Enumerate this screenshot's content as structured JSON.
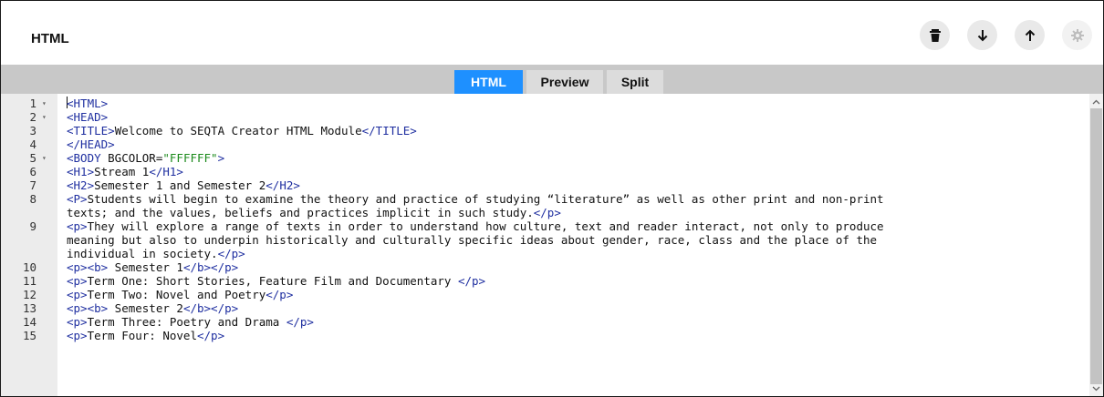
{
  "header": {
    "title": "HTML",
    "buttons": [
      {
        "name": "delete-button",
        "icon": "trash-icon"
      },
      {
        "name": "move-down-button",
        "icon": "arrow-down-icon"
      },
      {
        "name": "move-up-button",
        "icon": "arrow-up-icon"
      },
      {
        "name": "settings-button",
        "icon": "gear-icon",
        "disabled": true
      }
    ]
  },
  "tabs": [
    {
      "label": "HTML",
      "active": true
    },
    {
      "label": "Preview",
      "active": false
    },
    {
      "label": "Split",
      "active": false
    }
  ],
  "colors": {
    "accent": "#1e90ff",
    "tag": "#1f2fa0",
    "string": "#1b8a1b"
  },
  "editor": {
    "lines": [
      {
        "num": "1",
        "fold": true,
        "parts": [
          {
            "t": "<HTML>",
            "c": "tag"
          }
        ]
      },
      {
        "num": "2",
        "fold": true,
        "parts": [
          {
            "t": "<HEAD>",
            "c": "tag"
          }
        ]
      },
      {
        "num": "3",
        "fold": false,
        "parts": [
          {
            "t": "<TITLE>",
            "c": "tag"
          },
          {
            "t": "Welcome to SEQTA Creator HTML Module",
            "c": "text"
          },
          {
            "t": "</TITLE>",
            "c": "tag"
          }
        ]
      },
      {
        "num": "4",
        "fold": false,
        "parts": [
          {
            "t": "</HEAD>",
            "c": "tag"
          }
        ]
      },
      {
        "num": "5",
        "fold": true,
        "parts": [
          {
            "t": "<BODY ",
            "c": "tag"
          },
          {
            "t": "BGCOLOR=",
            "c": "text"
          },
          {
            "t": "\"FFFFFF\"",
            "c": "str"
          },
          {
            "t": ">",
            "c": "tag"
          }
        ]
      },
      {
        "num": "6",
        "fold": false,
        "parts": [
          {
            "t": "<H1>",
            "c": "tag"
          },
          {
            "t": "Stream 1",
            "c": "text"
          },
          {
            "t": "</H1>",
            "c": "tag"
          }
        ]
      },
      {
        "num": "7",
        "fold": false,
        "parts": [
          {
            "t": "<H2>",
            "c": "tag"
          },
          {
            "t": "Semester 1 and Semester 2",
            "c": "text"
          },
          {
            "t": "</H2>",
            "c": "tag"
          }
        ]
      },
      {
        "num": "8",
        "fold": false,
        "parts": [
          {
            "t": "<P>",
            "c": "tag"
          },
          {
            "t": "Students will begin to examine the theory and practice of studying “literature” as well as other print and non-print",
            "c": "text"
          }
        ]
      },
      {
        "num": "",
        "fold": false,
        "parts": [
          {
            "t": "texts; and the values, beliefs and practices implicit in such study.",
            "c": "text"
          },
          {
            "t": "</p>",
            "c": "tag"
          }
        ]
      },
      {
        "num": "9",
        "fold": false,
        "parts": [
          {
            "t": "<p>",
            "c": "tag"
          },
          {
            "t": "They will explore a range of texts in order to understand how culture, text and reader interact, not only to produce",
            "c": "text"
          }
        ]
      },
      {
        "num": "",
        "fold": false,
        "parts": [
          {
            "t": "meaning but also to underpin historically and culturally specific ideas about gender, race, class and the place of the",
            "c": "text"
          }
        ]
      },
      {
        "num": "",
        "fold": false,
        "parts": [
          {
            "t": "individual in society.",
            "c": "text"
          },
          {
            "t": "</p>",
            "c": "tag"
          }
        ]
      },
      {
        "num": "10",
        "fold": false,
        "parts": [
          {
            "t": "<p><b>",
            "c": "tag"
          },
          {
            "t": " Semester 1",
            "c": "text"
          },
          {
            "t": "</b></p>",
            "c": "tag"
          }
        ]
      },
      {
        "num": "11",
        "fold": false,
        "parts": [
          {
            "t": "<p>",
            "c": "tag"
          },
          {
            "t": "Term One: Short Stories, Feature Film and Documentary ",
            "c": "text"
          },
          {
            "t": "</p>",
            "c": "tag"
          }
        ]
      },
      {
        "num": "12",
        "fold": false,
        "parts": [
          {
            "t": "<p>",
            "c": "tag"
          },
          {
            "t": "Term Two: Novel and Poetry",
            "c": "text"
          },
          {
            "t": "</p>",
            "c": "tag"
          }
        ]
      },
      {
        "num": "13",
        "fold": false,
        "parts": [
          {
            "t": "<p><b>",
            "c": "tag"
          },
          {
            "t": " Semester 2",
            "c": "text"
          },
          {
            "t": "</b></p>",
            "c": "tag"
          }
        ]
      },
      {
        "num": "14",
        "fold": false,
        "parts": [
          {
            "t": "<p>",
            "c": "tag"
          },
          {
            "t": "Term Three: Poetry and Drama ",
            "c": "text"
          },
          {
            "t": "</p>",
            "c": "tag"
          }
        ]
      },
      {
        "num": "15",
        "fold": false,
        "parts": [
          {
            "t": "<p>",
            "c": "tag"
          },
          {
            "t": "Term Four: Novel",
            "c": "text"
          },
          {
            "t": "</p>",
            "c": "tag"
          }
        ]
      }
    ]
  }
}
